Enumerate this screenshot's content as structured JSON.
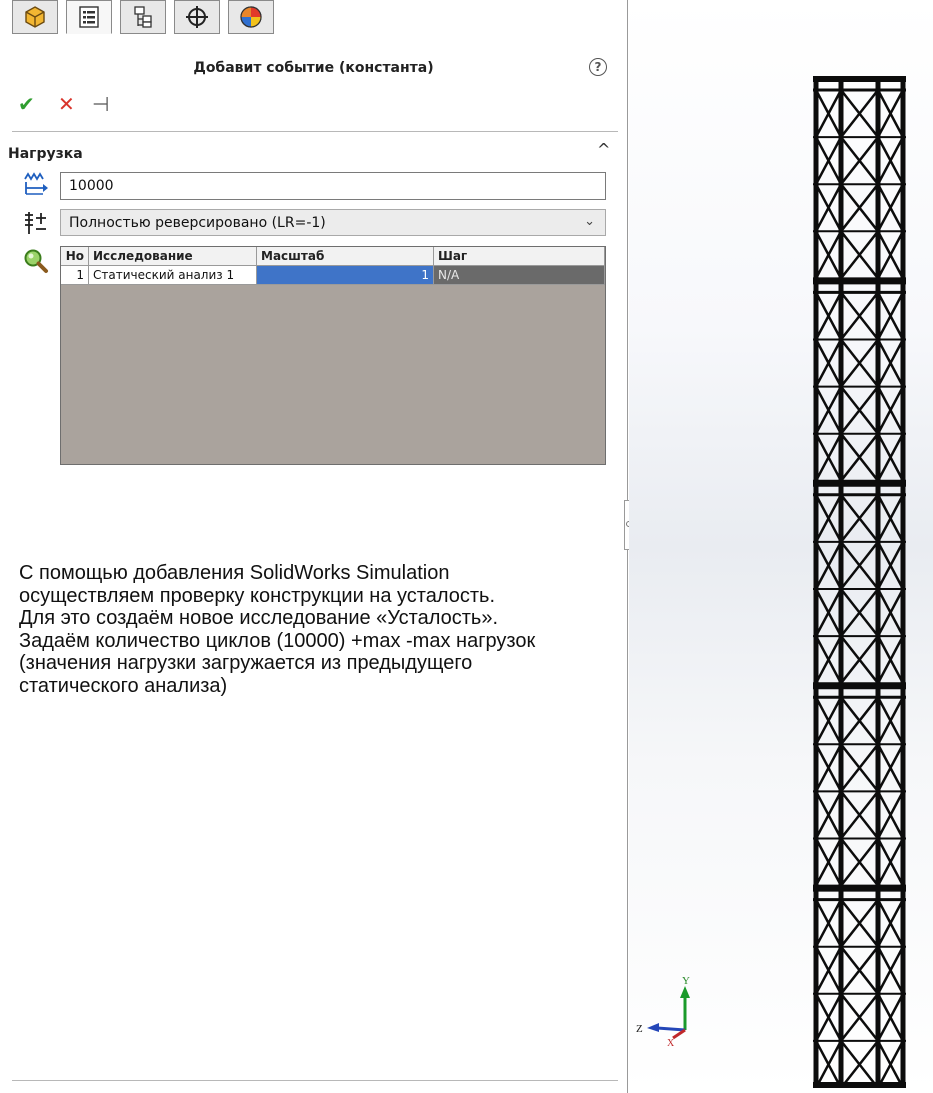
{
  "panel": {
    "tabs": [
      {
        "name": "part-tab",
        "icon": "cube-icon"
      },
      {
        "name": "property-manager-tab",
        "icon": "property-manager-icon"
      },
      {
        "name": "configuration-manager-tab",
        "icon": "configuration-manager-icon"
      },
      {
        "name": "dimxpert-tab",
        "icon": "crosshair-icon"
      },
      {
        "name": "display-manager-tab",
        "icon": "appearance-sphere-icon"
      }
    ],
    "title": "Добавит событие (константа)",
    "help_glyph": "?",
    "actions": {
      "ok_glyph": "✔",
      "cancel_glyph": "✕",
      "pin_glyph": "⊣"
    },
    "section": {
      "label": "Нагрузка",
      "collapse_glyph": "^"
    },
    "cycles_value": "10000",
    "loading_type": {
      "selected": "Полностью реверсировано (LR=-1)",
      "arrow_glyph": "⌄"
    },
    "table": {
      "headers": [
        "Но",
        "Исследование",
        "Масштаб",
        "Шаг"
      ],
      "rows": [
        [
          "1",
          "Статический анализ 1",
          "1",
          "N/A"
        ]
      ]
    },
    "caption_lines": [
      "С помощью добавления SolidWorks Simulation",
      "осуществляем проверку конструкции на усталость.",
      "Для это создаём новое исследование «Усталость».",
      "Задаём количество циклов (10000) +max -max нагрузок",
      "(значения нагрузки загружается из предыдущего",
      "статического анализа)"
    ]
  },
  "viewport": {
    "triad": {
      "y_label": "Y",
      "z_label": "Z",
      "x_label": "X"
    }
  },
  "colors": {
    "ok": "#2f9e2f",
    "cancel": "#d9342b",
    "selected_cell": "#3f74c8",
    "grid_background": "#aaa39d"
  }
}
